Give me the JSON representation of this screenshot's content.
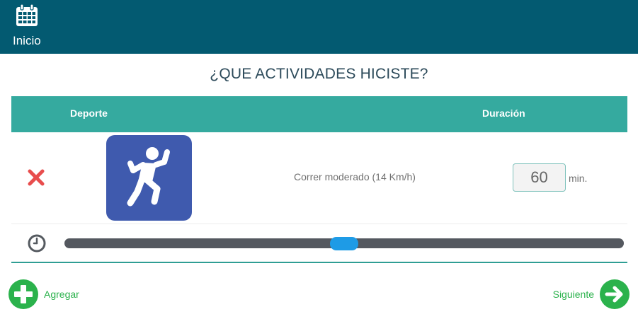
{
  "header": {
    "home_label": "Inicio",
    "home_icon": "calendar-icon"
  },
  "page": {
    "title": "¿QUE ACTIVIDADES HICISTE?"
  },
  "table": {
    "columns": [
      "Deporte",
      "Duración"
    ],
    "rows": [
      {
        "sport": "Correr moderado (14 Km/h)",
        "sport_icon": "running-person-icon",
        "duration": "60",
        "unit": "min.",
        "slider_fraction": 0.5
      }
    ]
  },
  "actions": {
    "add_label": "Agregar",
    "next_label": "Siguiente"
  },
  "colors": {
    "header_bg": "#035a71",
    "table_header_bg": "#35aa9f",
    "sport_tile_bg": "#3f5aae",
    "delete": "#e84d4d",
    "action_green": "#2bb24c",
    "slider_thumb": "#1e9be6"
  }
}
